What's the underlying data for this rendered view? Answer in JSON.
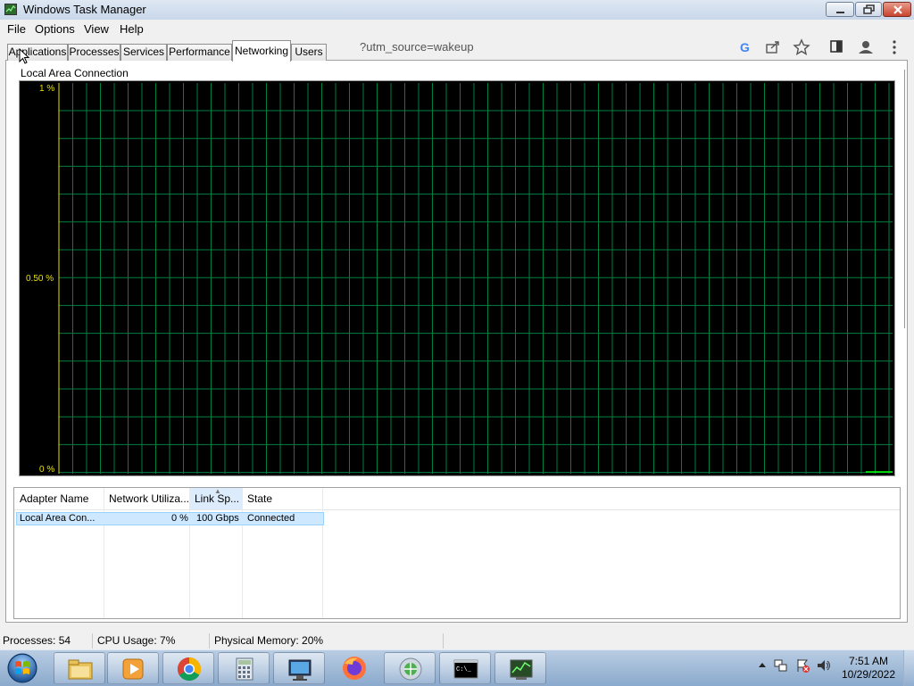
{
  "window": {
    "title": "Windows Task Manager",
    "controls": [
      "minimize",
      "maximize",
      "close"
    ]
  },
  "menu": [
    "File",
    "Options",
    "View",
    "Help"
  ],
  "tabs": [
    {
      "label": "Applications",
      "active": false
    },
    {
      "label": "Processes",
      "active": false
    },
    {
      "label": "Services",
      "active": false
    },
    {
      "label": "Performance",
      "active": false
    },
    {
      "label": "Networking",
      "active": true
    },
    {
      "label": "Users",
      "active": false
    }
  ],
  "browser_overlay": {
    "url_fragment": "?utm_source=wakeup",
    "icons": [
      "google-icon",
      "share-icon",
      "star-icon",
      "sidebar-icon",
      "profile-icon",
      "kebab-menu-icon"
    ]
  },
  "graph": {
    "title": "Local Area Connection",
    "y_labels": {
      "top": "1 %",
      "mid": "0.50 %",
      "bottom": "0 %"
    },
    "colors": {
      "background": "#000000",
      "grid": "#008040",
      "axis": "#e8e000",
      "trace": "#00ff00"
    }
  },
  "chart_data": {
    "type": "line",
    "title": "Local Area Connection",
    "ylabel": "",
    "ylim": [
      0,
      1
    ],
    "ytick_labels": [
      "0 %",
      "0.50 %",
      "1 %"
    ],
    "grid": true,
    "series": [
      {
        "values": [
          0,
          0,
          0,
          0,
          0,
          0,
          0,
          0,
          0,
          0
        ]
      }
    ]
  },
  "adapters": {
    "columns": [
      "Adapter Name",
      "Network Utiliza...",
      "Link Sp...",
      "State"
    ],
    "sorted_column": "Link Sp...",
    "rows": [
      {
        "name": "Local Area Con...",
        "utilization": "0 %",
        "link_speed": "100 Gbps",
        "state": "Connected"
      }
    ]
  },
  "status": {
    "processes": "Processes: 54",
    "cpu": "CPU Usage: 7%",
    "memory": "Physical Memory: 20%"
  },
  "taskbar": {
    "apps": [
      "windows-explorer-icon",
      "media-player-icon",
      "chrome-icon",
      "calculator-icon",
      "computer-icon",
      "firefox-icon",
      "network-icon",
      "cmd-icon",
      "task-manager-icon"
    ],
    "time": "7:51 AM",
    "date": "10/29/2022"
  }
}
